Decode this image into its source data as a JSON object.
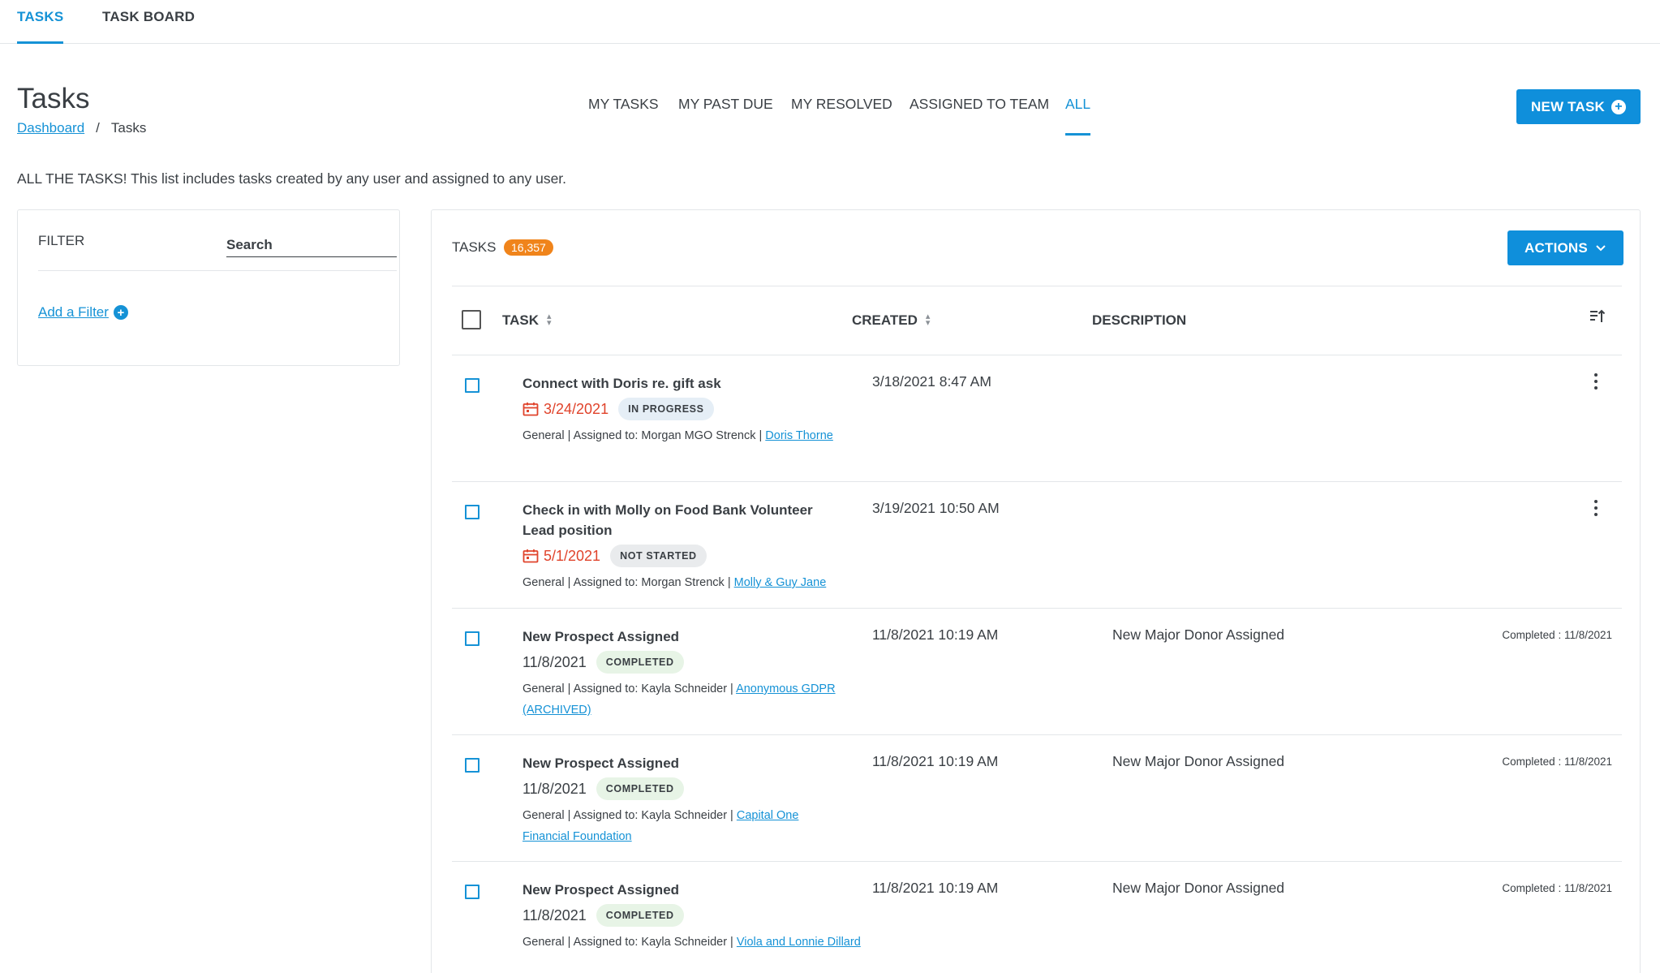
{
  "top_tabs": [
    {
      "label": "TASKS",
      "active": true
    },
    {
      "label": "TASK BOARD",
      "active": false
    }
  ],
  "page": {
    "title": "Tasks",
    "breadcrumb": {
      "home": "Dashboard",
      "separator": "/",
      "current": "Tasks"
    },
    "intro": "ALL THE TASKS! This list includes tasks created by any user and assigned to any user."
  },
  "filter_tabs": [
    {
      "label": "MY TASKS"
    },
    {
      "label": "MY PAST DUE"
    },
    {
      "label": "MY RESOLVED"
    },
    {
      "label": "ASSIGNED TO TEAM"
    },
    {
      "label": "ALL",
      "active": true
    }
  ],
  "new_task_label": "NEW TASK",
  "filter_panel": {
    "label": "FILTER",
    "search_placeholder": "Search",
    "add_filter_label": "Add a Filter"
  },
  "tasks_panel": {
    "label": "TASKS",
    "count": "16,357",
    "actions_label": "ACTIONS",
    "columns": {
      "task": "TASK",
      "created": "CREATED",
      "description": "DESCRIPTION"
    }
  },
  "rows": [
    {
      "title": "Connect with Doris re. gift ask",
      "due": "3/24/2021",
      "overdue": true,
      "status": "IN PROGRESS",
      "meta_prefix": "General | Assigned to: Morgan MGO Strenck |",
      "link": "Doris Thorne",
      "created": "3/18/2021 8:47 AM",
      "description": "",
      "completed": ""
    },
    {
      "title": "Check in with Molly on Food Bank Volunteer Lead position",
      "due": "5/1/2021",
      "overdue": true,
      "status": "NOT STARTED",
      "meta_prefix": "General | Assigned to: Morgan Strenck |",
      "link": "Molly & Guy Jane",
      "created": "3/19/2021 10:50 AM",
      "description": "",
      "completed": ""
    },
    {
      "title": "New Prospect Assigned",
      "due": "11/8/2021",
      "overdue": false,
      "status": "COMPLETED",
      "meta_prefix": "General | Assigned to: Kayla Schneider |",
      "link": "Anonymous GDPR (ARCHIVED)",
      "created": "11/8/2021 10:19 AM",
      "description": "New Major Donor Assigned",
      "completed": "Completed : 11/8/2021"
    },
    {
      "title": "New Prospect Assigned",
      "due": "11/8/2021",
      "overdue": false,
      "status": "COMPLETED",
      "meta_prefix": "General | Assigned to: Kayla Schneider |",
      "link": "Capital One Financial Foundation",
      "created": "11/8/2021 10:19 AM",
      "description": "New Major Donor Assigned",
      "completed": "Completed : 11/8/2021"
    },
    {
      "title": "New Prospect Assigned",
      "due": "11/8/2021",
      "overdue": false,
      "status": "COMPLETED",
      "meta_prefix": "General | Assigned to: Kayla Schneider |",
      "link": "Viola and Lonnie Dillard",
      "created": "11/8/2021 10:19 AM",
      "description": "New Major Donor Assigned",
      "completed": "Completed : 11/8/2021"
    }
  ],
  "colors": {
    "accent": "#1592d6",
    "button": "#0f8fdb",
    "overdue": "#e0432b",
    "badge": "#f0841b"
  }
}
